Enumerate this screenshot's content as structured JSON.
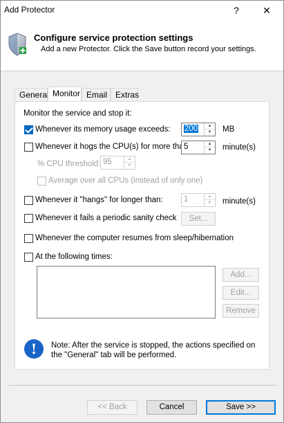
{
  "window": {
    "title": "Add Protector",
    "help_glyph": "?",
    "close_glyph": "✕"
  },
  "header": {
    "title": "Configure service protection settings",
    "subtitle": "Add a new Protector. Click the Save button record your settings.",
    "icon": "shield-plus-icon"
  },
  "tabs": [
    {
      "label": "General",
      "active": false
    },
    {
      "label": "Monitor",
      "active": true
    },
    {
      "label": "Email",
      "active": false
    },
    {
      "label": "Extras",
      "active": false
    }
  ],
  "monitor": {
    "section_label": "Monitor the service and stop it:",
    "memory": {
      "label": "Whenever its memory usage exceeds:",
      "checked": true,
      "value": "200",
      "unit": "MB"
    },
    "cpu": {
      "label": "Whenever it hogs the CPU(s) for more than:",
      "checked": false,
      "value": "5",
      "unit": "minute(s)"
    },
    "cpu_threshold": {
      "label": "% CPU threshold:",
      "value": "95"
    },
    "cpu_average": {
      "label": "Average over all CPUs (instead of only one)",
      "checked": false
    },
    "hangs": {
      "label": "Whenever it \"hangs\" for longer than:",
      "checked": false,
      "value": "1",
      "unit": "minute(s)"
    },
    "sanity": {
      "label": "Whenever it fails a periodic sanity check",
      "checked": false,
      "button": "Set..."
    },
    "resume": {
      "label": "Whenever the computer resumes from sleep/hibernation",
      "checked": false
    },
    "times": {
      "label": "At the following times:",
      "checked": false,
      "add_button": "Add...",
      "edit_button": "Edit...",
      "remove_button": "Remove"
    },
    "note": "Note: After the service is stopped, the actions specified on the \"General\" tab will be performed."
  },
  "footer": {
    "back_label": "<< Back",
    "cancel_label": "Cancel",
    "save_label": "Save >>"
  },
  "colors": {
    "accent": "#0067c0",
    "info": "#1a64c8"
  }
}
